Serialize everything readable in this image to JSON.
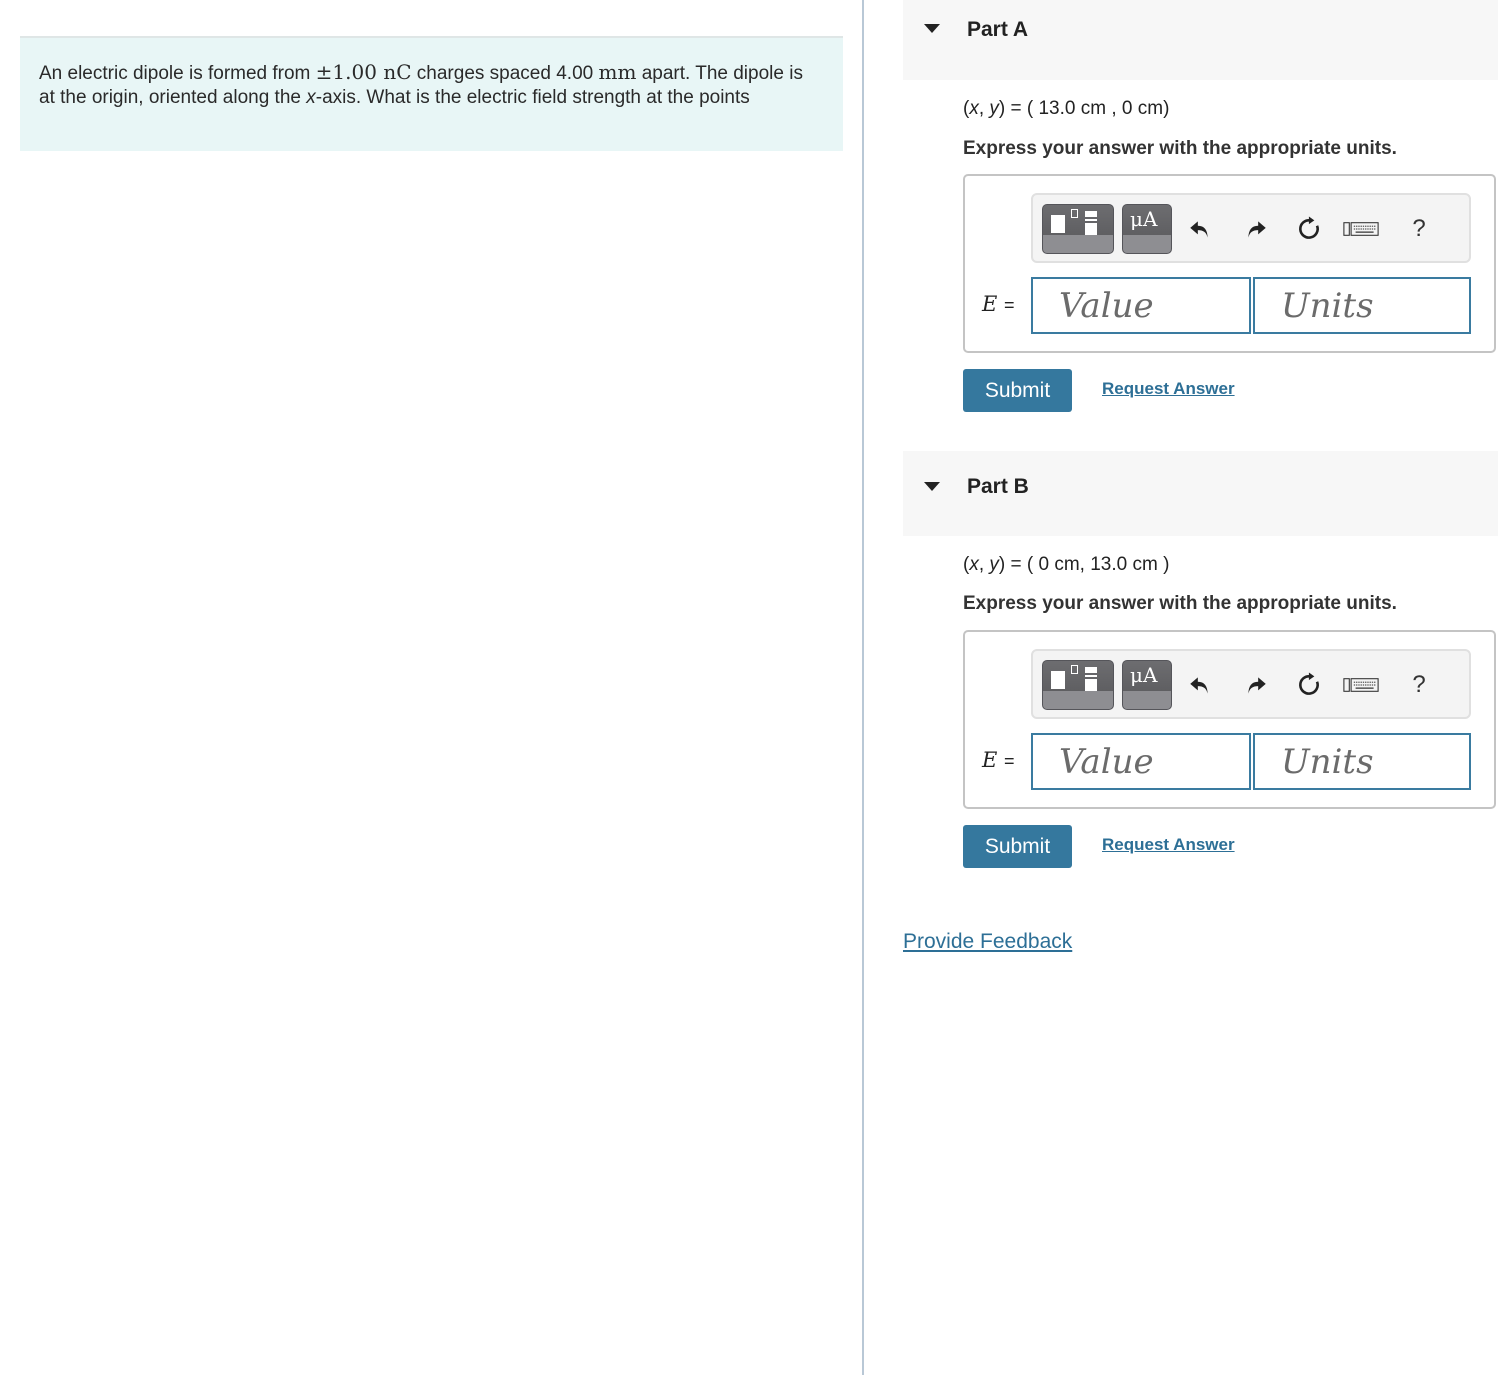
{
  "problem": {
    "text_before_charge": "An electric dipole is formed from ",
    "charge": "±1.00 nC",
    "text_after_charge": " charges spaced ",
    "spacing_value": "4.00",
    "spacing_unit": "mm",
    "text_after_spacing": " apart. The dipole is at the origin, oriented along the ",
    "axis": "x",
    "text_end": "-axis. What is the electric field strength at the points"
  },
  "parts": [
    {
      "title": "Part A",
      "coords_prefix_x": "x",
      "coords_prefix_y": "y",
      "coords_eq": ") = ( ",
      "coords_value": "13.0 cm , 0 cm)",
      "instruction": "Express your answer with the appropriate units.",
      "toolbar": {
        "templates_icon": "templates-icon",
        "units_label": "μA",
        "undo_icon": "undo-icon",
        "redo_icon": "redo-icon",
        "reset_icon": "reset-icon",
        "keyboard_icon": "keyboard-icon",
        "help_label": "?"
      },
      "variable": "E",
      "equals": "=",
      "value_placeholder": "Value",
      "units_placeholder": "Units",
      "submit_label": "Submit",
      "request_label": "Request Answer"
    },
    {
      "title": "Part B",
      "coords_prefix_x": "x",
      "coords_prefix_y": "y",
      "coords_eq": ") = ( ",
      "coords_value": "0 cm, 13.0 cm )",
      "instruction": "Express your answer with the appropriate units.",
      "toolbar": {
        "templates_icon": "templates-icon",
        "units_label": "μA",
        "undo_icon": "undo-icon",
        "redo_icon": "redo-icon",
        "reset_icon": "reset-icon",
        "keyboard_icon": "keyboard-icon",
        "help_label": "?"
      },
      "variable": "E",
      "equals": "=",
      "value_placeholder": "Value",
      "units_placeholder": "Units",
      "submit_label": "Submit",
      "request_label": "Request Answer"
    }
  ],
  "feedback_label": "Provide Feedback",
  "colors": {
    "accent": "#35789e",
    "link": "#2d6f96",
    "problem_bg": "#e8f6f6",
    "part_header_bg": "#f7f7f7",
    "divider": "#b9c8d6"
  }
}
